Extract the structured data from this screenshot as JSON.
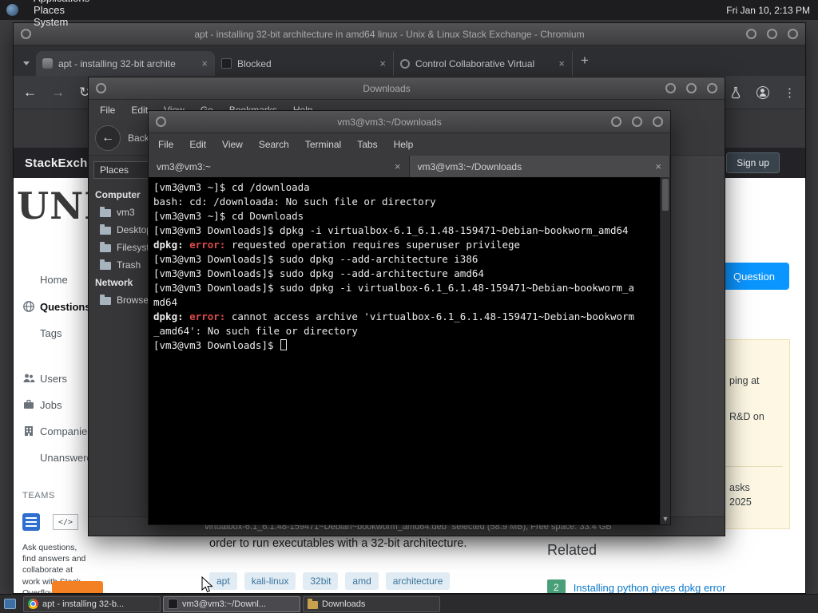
{
  "panel": {
    "menus": [
      {
        "label": "Applications"
      },
      {
        "label": "Places"
      },
      {
        "label": "System"
      }
    ],
    "clock": "Fri Jan 10, 2:13 PM"
  },
  "icons": {
    "back": "←",
    "forward": "→",
    "reload": "↻",
    "kebab": "⋮",
    "scroll_down": "▼",
    "close": "×",
    "dropdown": "▾"
  },
  "browser": {
    "title": "apt - installing 32-bit architecture in amd64 linux - Unix & Linux Stack Exchange - Chromium",
    "tabs": [
      {
        "label": "apt - installing 32-bit archite"
      },
      {
        "label": "Blocked"
      },
      {
        "label": "Control Collaborative Virtual"
      }
    ],
    "new_tab": "+",
    "page": {
      "brand": "StackExchange",
      "signup_label": "Sign up",
      "site_logo": "UNIX",
      "nav": [
        {
          "label": "Home",
          "icon": ""
        },
        {
          "label": "Questions",
          "icon": "globe",
          "active": true
        },
        {
          "label": "Tags",
          "icon": ""
        },
        {
          "label": "Users",
          "icon": "people"
        },
        {
          "label": "Jobs",
          "icon": "briefcase"
        },
        {
          "label": "Companies",
          "icon": "building"
        },
        {
          "label": "Unanswered",
          "icon": ""
        }
      ],
      "teams_heading": "TEAMS",
      "teams_text": "Ask questions, find answers and collaborate at work with Stack Overflow for Teams.",
      "ask_button": "Question",
      "snippet": "order to run executables with a 32-bit architecture.",
      "tags": [
        "apt",
        "kali-linux",
        "32bit",
        "amd",
        "architecture"
      ],
      "related_heading": "Related",
      "related": [
        {
          "count": "2",
          "title": "Installing python gives dpkg error"
        }
      ],
      "sidebar_fragments": [
        "ping at",
        "R&D on",
        "asks",
        "2025"
      ]
    },
    "colors": {
      "ask_button": "#0a95ff",
      "tag_bg": "#e1ecf4",
      "tag_text": "#39739d",
      "link": "#0b78cc",
      "teams_button": "#f48024",
      "yellow_module_bg": "#fdf7e3"
    }
  },
  "filemanager": {
    "title": "Downloads",
    "menus": [
      "File",
      "Edit",
      "View",
      "Go",
      "Bookmarks",
      "Help"
    ],
    "back_label": "Back",
    "places_combo": "Places",
    "sidebar": [
      {
        "label": "Computer",
        "type": "header"
      },
      {
        "label": "vm3",
        "type": "item"
      },
      {
        "label": "Desktop",
        "type": "item"
      },
      {
        "label": "Filesystem",
        "type": "item"
      },
      {
        "label": "Trash",
        "type": "item"
      },
      {
        "label": "Network",
        "type": "header"
      },
      {
        "label": "Browse Network",
        "type": "item"
      }
    ],
    "statusbar": "\"virtualbox-6.1_6.1.48-159471~Debian~bookworm_amd64.deb\" selected (58.9 MB), Free space: 33.4 GB"
  },
  "terminal": {
    "title": "vm3@vm3:~/Downloads",
    "menus": [
      "File",
      "Edit",
      "View",
      "Search",
      "Terminal",
      "Tabs",
      "Help"
    ],
    "tabs": [
      {
        "label": "vm3@vm3:~",
        "active": false
      },
      {
        "label": "vm3@vm3:~/Downloads",
        "active": true
      }
    ],
    "error_color": "#df4b4b",
    "lines": [
      {
        "segments": [
          {
            "text": "[vm3@vm3 ~]$ cd /downloada"
          }
        ]
      },
      {
        "segments": [
          {
            "text": "bash: cd: /downloada: No such file or directory"
          }
        ]
      },
      {
        "segments": [
          {
            "text": "[vm3@vm3 ~]$ cd Downloads"
          }
        ]
      },
      {
        "segments": [
          {
            "text": "[vm3@vm3 Downloads]$ dpkg -i virtualbox-6.1_6.1.48-159471~Debian~bookworm_amd64"
          }
        ]
      },
      {
        "segments": [
          {
            "text": "dpkg: ",
            "style": "bold"
          },
          {
            "text": "error:",
            "style": "error"
          },
          {
            "text": " requested operation requires superuser privilege"
          }
        ]
      },
      {
        "segments": [
          {
            "text": "[vm3@vm3 Downloads]$ sudo dpkg --add-architecture i386"
          }
        ]
      },
      {
        "segments": [
          {
            "text": "[vm3@vm3 Downloads]$ sudo dpkg --add-architecture amd64"
          }
        ]
      },
      {
        "segments": [
          {
            "text": "[vm3@vm3 Downloads]$ sudo dpkg -i virtualbox-6.1_6.1.48-159471~Debian~bookworm_a"
          }
        ]
      },
      {
        "segments": [
          {
            "text": "md64"
          }
        ]
      },
      {
        "segments": [
          {
            "text": "dpkg: ",
            "style": "bold"
          },
          {
            "text": "error:",
            "style": "error"
          },
          {
            "text": " cannot access archive 'virtualbox-6.1_6.1.48-159471~Debian~bookworm"
          }
        ]
      },
      {
        "segments": [
          {
            "text": "_amd64': No such file or directory"
          }
        ]
      },
      {
        "segments": [
          {
            "text": "[vm3@vm3 Downloads]$ "
          }
        ],
        "cursor": true
      }
    ]
  },
  "taskbar": {
    "items": [
      {
        "label": "apt - installing 32-b...",
        "icon": "chromium",
        "active": false
      },
      {
        "label": "vm3@vm3:~/Downl...",
        "icon": "terminal",
        "active": true
      },
      {
        "label": "Downloads",
        "icon": "folder",
        "active": false
      }
    ]
  }
}
